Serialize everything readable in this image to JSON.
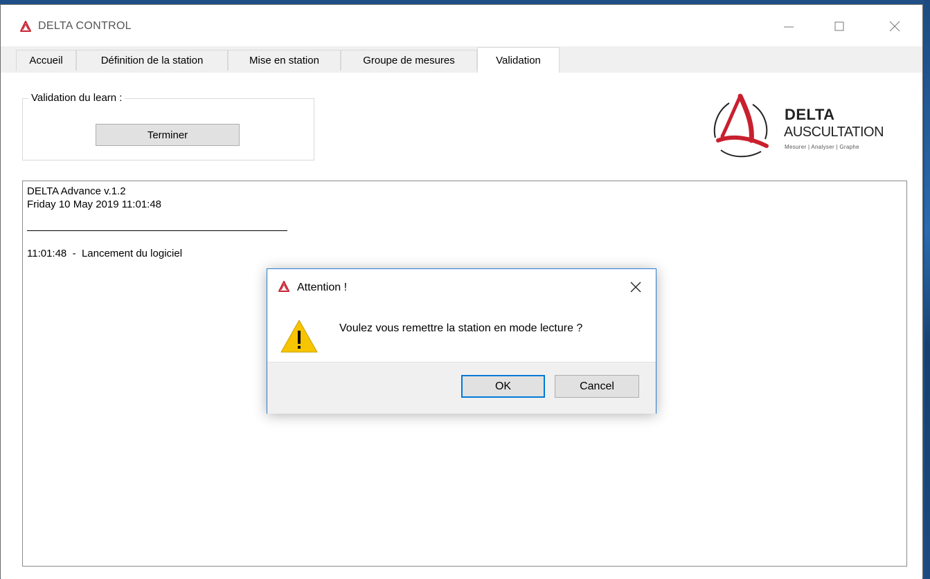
{
  "window": {
    "title": "DELTA CONTROL"
  },
  "tabs": [
    {
      "label": "Accueil",
      "active": false
    },
    {
      "label": "Définition de la station",
      "active": false
    },
    {
      "label": "Mise en station",
      "active": false
    },
    {
      "label": "Groupe de mesures",
      "active": false
    },
    {
      "label": "Validation",
      "active": true
    }
  ],
  "validation": {
    "group_title": "Validation du learn :",
    "terminer_label": "Terminer"
  },
  "logo": {
    "name": "DELTA",
    "subtitle": "AUSCULTATION",
    "tagline": "Mesurer | Analyser | Graphe",
    "accent_color": "#c8202f"
  },
  "log": {
    "version": "DELTA Advance v.1.2",
    "date": "Friday 10 May 2019 11:01:48",
    "separator": "______________________________________",
    "entries": [
      "11:01:48  -  Lancement du logiciel"
    ]
  },
  "dialog": {
    "title": "Attention !",
    "message": "Voulez vous remettre la station en mode lecture ?",
    "ok_label": "OK",
    "cancel_label": "Cancel",
    "icon": "warning-icon",
    "accent_color": "#0078d7"
  }
}
